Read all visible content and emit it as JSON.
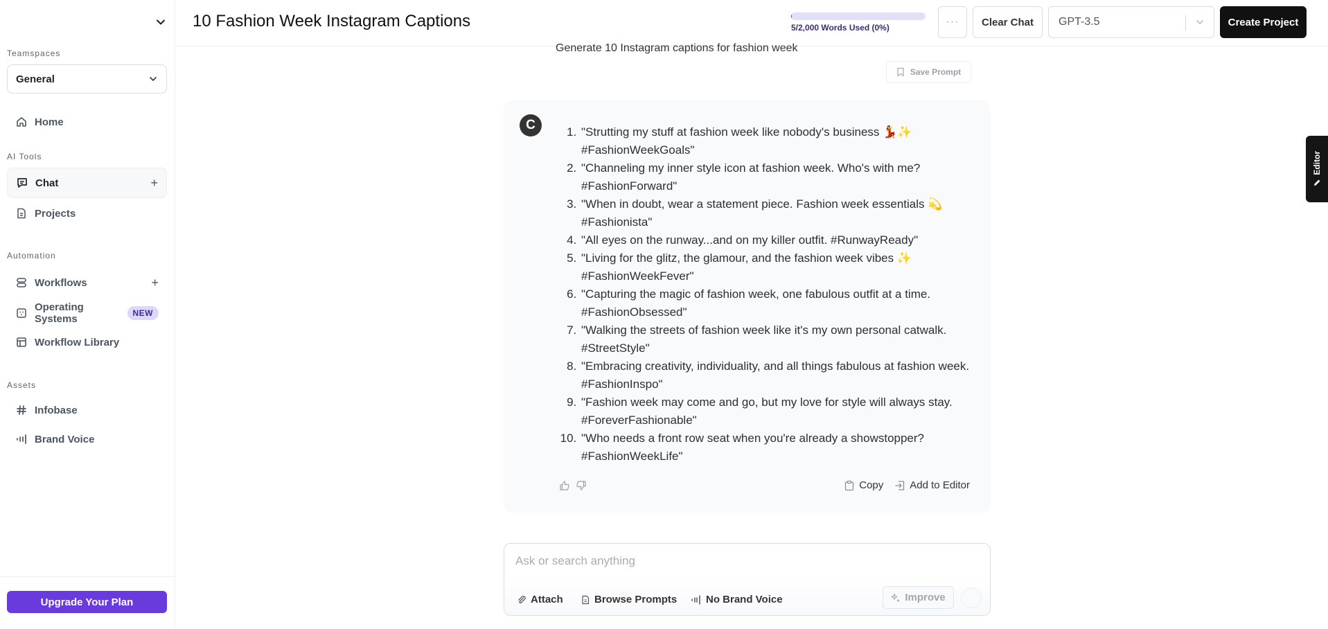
{
  "sidebar": {
    "teamspaces_label": "Teamspaces",
    "teamspace_selected": "General",
    "home_label": "Home",
    "ai_tools_label": "AI Tools",
    "ai_tools": [
      {
        "label": "Chat",
        "icon": "chat-icon",
        "active": true,
        "has_add": true
      },
      {
        "label": "Projects",
        "icon": "document-icon",
        "active": false,
        "has_add": false
      }
    ],
    "automation_label": "Automation",
    "automation": [
      {
        "label": "Workflows",
        "icon": "workflow-icon",
        "has_add": true
      },
      {
        "label": "Operating Systems",
        "icon": "os-icon",
        "badge": "NEW"
      },
      {
        "label": "Workflow Library",
        "icon": "library-icon"
      }
    ],
    "assets_label": "Assets",
    "assets": [
      {
        "label": "Infobase",
        "icon": "hash-icon"
      },
      {
        "label": "Brand Voice",
        "icon": "voice-icon"
      }
    ],
    "upgrade_label": "Upgrade Your Plan"
  },
  "header": {
    "title": "10 Fashion Week Instagram Captions",
    "usage_text": "5/2,000 Words Used (0%)",
    "usage_percent": 0.25,
    "more_label": "···",
    "clear_chat_label": "Clear Chat",
    "model_selected": "GPT-3.5",
    "create_project_label": "Create Project"
  },
  "chat": {
    "user_prompt": "Generate 10 Instagram captions for fashion week",
    "save_prompt_label": "Save Prompt",
    "assistant_avatar": "C",
    "response_items": [
      "\"Strutting my stuff at fashion week like nobody's business 💃✨ #FashionWeekGoals\"",
      "\"Channeling my inner style icon at fashion week. Who's with me? #FashionForward\"",
      "\"When in doubt, wear a statement piece. Fashion week essentials 💫 #Fashionista\"",
      "\"All eyes on the runway...and on my killer outfit. #RunwayReady\"",
      "\"Living for the glitz, the glamour, and the fashion week vibes ✨ #FashionWeekFever\"",
      "\"Capturing the magic of fashion week, one fabulous outfit at a time. #FashionObsessed\"",
      "\"Walking the streets of fashion week like it's my own personal catwalk. #StreetStyle\"",
      "\"Embracing creativity, individuality, and all things fabulous at fashion week. #FashionInspo\"",
      "\"Fashion week may come and go, but my love for style will always stay. #ForeverFashionable\"",
      "\"Who needs a front row seat when you're already a showstopper? #FashionWeekLife\""
    ],
    "copy_label": "Copy",
    "add_to_editor_label": "Add to Editor"
  },
  "input": {
    "placeholder": "Ask or search anything",
    "value": "",
    "attach_label": "Attach",
    "browse_prompts_label": "Browse Prompts",
    "brand_voice_label": "No Brand Voice",
    "improve_label": "Improve"
  },
  "editor_tab": {
    "label": "Editor"
  },
  "colors": {
    "accent": "#6a3bdc",
    "badge_bg": "#dcd8fb",
    "primary_dark": "#111111"
  }
}
